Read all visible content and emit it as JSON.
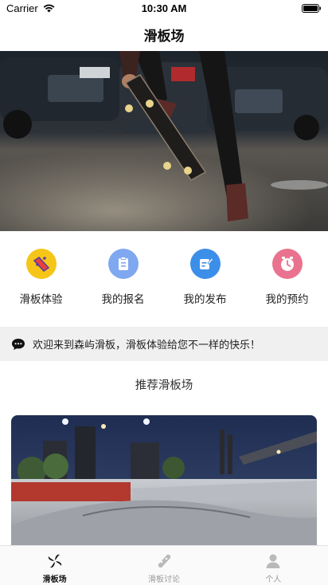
{
  "status_bar": {
    "carrier": "Carrier",
    "time": "10:30 AM"
  },
  "nav": {
    "title": "滑板场"
  },
  "quick_actions": [
    {
      "label": "滑板体验",
      "icon": "skateboard-icon",
      "color": "#f5c518"
    },
    {
      "label": "我的报名",
      "icon": "clipboard-icon",
      "color": "#7fa8f0"
    },
    {
      "label": "我的发布",
      "icon": "edit-note-icon",
      "color": "#3b8fe8"
    },
    {
      "label": "我的预约",
      "icon": "clock-icon",
      "color": "#e9738e"
    }
  ],
  "notice": {
    "text": "欢迎来到森屿滑板，滑板体验给您不一样的快乐！",
    "icon": "chat-bubble-icon"
  },
  "recommend": {
    "title": "推荐滑板场"
  },
  "tabs": [
    {
      "label": "滑板场",
      "icon": "pinwheel-icon",
      "active": true
    },
    {
      "label": "滑板讨论",
      "icon": "skateboard-icon",
      "active": false
    },
    {
      "label": "个人",
      "icon": "person-icon",
      "active": false
    }
  ],
  "colors": {
    "accent": "#111111",
    "inactive": "#9a9a9a",
    "notice_bg": "#f0f0f0"
  }
}
